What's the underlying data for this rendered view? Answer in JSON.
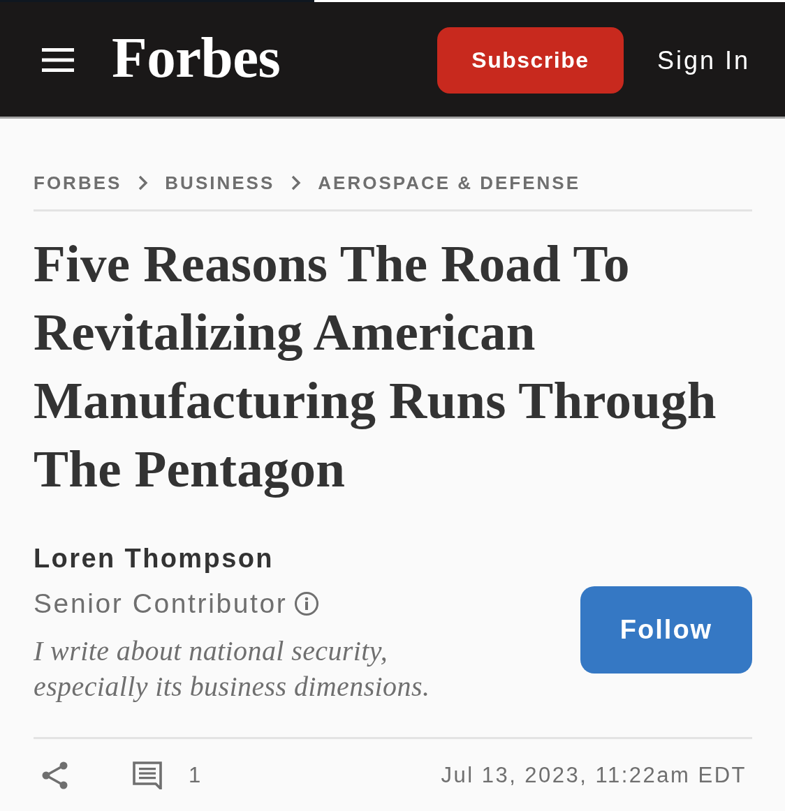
{
  "reading_progress": {
    "level": 0.4
  },
  "header": {
    "logo": "Forbes",
    "subscribe_button": "Subscribe",
    "sign_in": "Sign In"
  },
  "breadcrumbs": [
    "FORBES",
    "BUSINESS",
    "AEROSPACE & DEFENSE"
  ],
  "article": {
    "title": "Five Reasons The Road To Revitalizing American Manufacturing Runs Through The Pentagon",
    "author": {
      "name": "Loren Thompson",
      "role": "Senior Contributor",
      "bio": "I write about national security, especially its business dimensions.",
      "follow_button": "Follow"
    },
    "comment_count": "1",
    "published": "Jul 13, 2023, 11:22am EDT"
  }
}
